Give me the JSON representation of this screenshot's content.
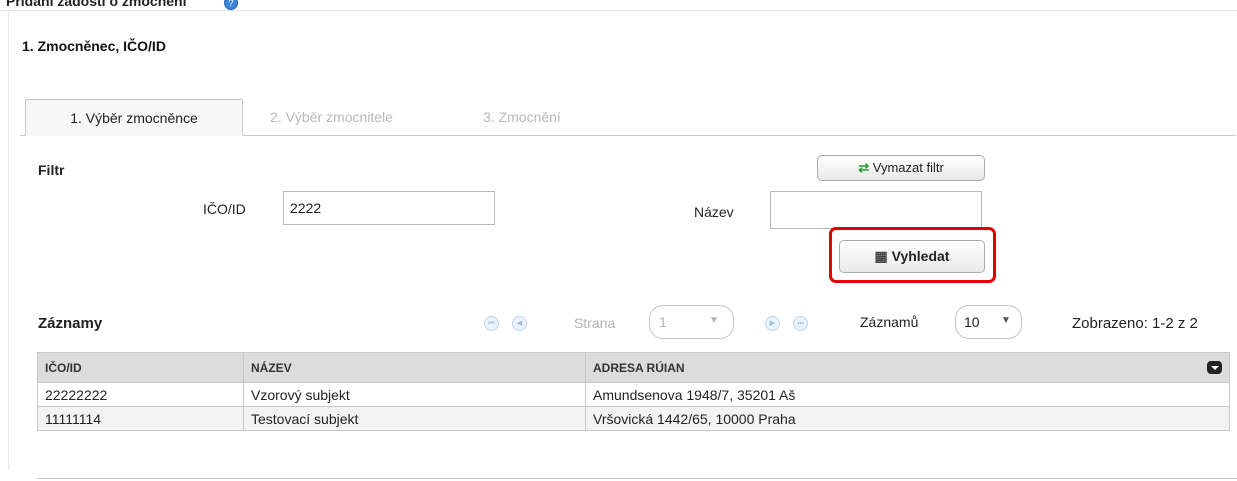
{
  "page": {
    "title": "Přidání žádosti o zmocnění",
    "help_icon": "?"
  },
  "section": {
    "title": "1. Zmocněnec, IČO/ID"
  },
  "tabs": [
    {
      "label": "1. Výběr zmocněnce",
      "state": "active"
    },
    {
      "label": "2. Výběr zmocnitele",
      "state": "disabled"
    },
    {
      "label": "3. Zmocnění",
      "state": "disabled"
    }
  ],
  "filter": {
    "title": "Filtr",
    "ico_label": "IČO/ID",
    "ico_value": "2222",
    "name_label": "Název",
    "name_value": "",
    "clear_button": "Vymazat filtr",
    "search_button": "Vyhledat"
  },
  "records": {
    "title": "Záznamy",
    "page_label": "Strana",
    "page_value": "1",
    "per_page_label": "Záznamů",
    "per_page_value": "10",
    "shown": "Zobrazeno: 1-2 z 2"
  },
  "table": {
    "columns": [
      "IČO/ID",
      "NÁZEV",
      "ADRESA RÚIAN"
    ],
    "rows": [
      {
        "ico": "22222222",
        "name": "Vzorový subjekt",
        "address": "Amundsenova 1948/7, 35201 Aš"
      },
      {
        "ico": "11111114",
        "name": "Testovací subjekt",
        "address": "Vršovická 1442/65, 10000 Praha"
      }
    ]
  },
  "colors": {
    "highlight": "#e00000",
    "accent": "#3b86d6"
  }
}
